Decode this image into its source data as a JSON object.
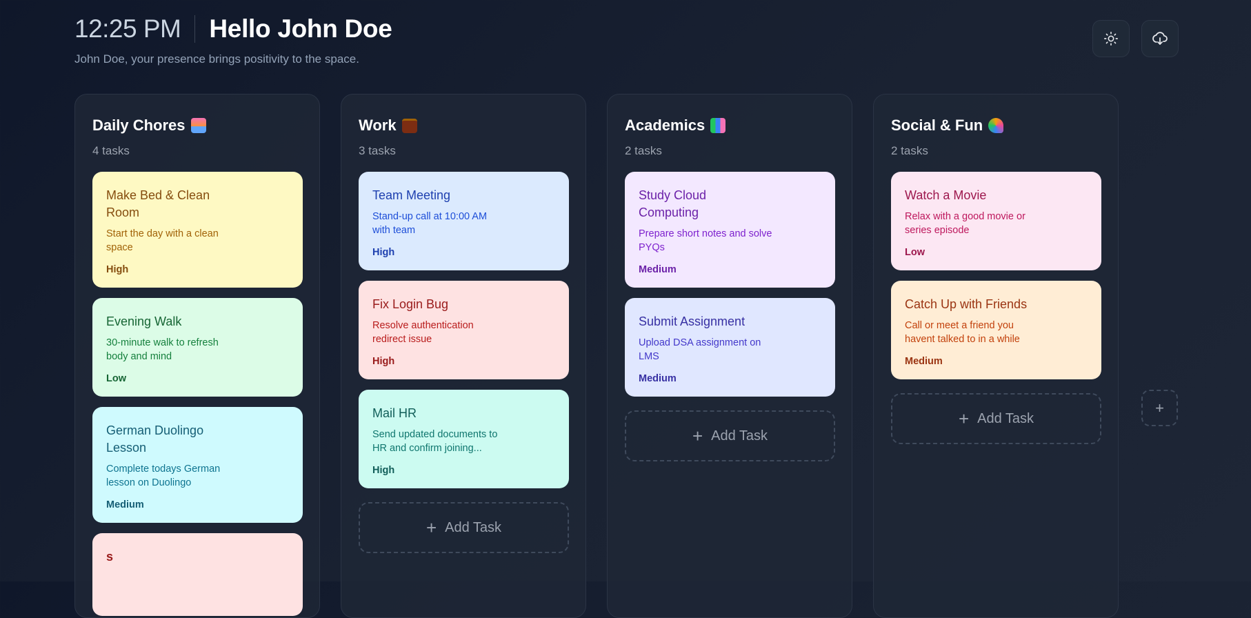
{
  "header": {
    "time": "12:25 PM",
    "greeting": "Hello John Doe",
    "subtitle": "John Doe, your presence brings positivity to the space."
  },
  "actions": [
    {
      "icon": "sun-icon"
    },
    {
      "icon": "cloud-download-icon"
    }
  ],
  "columns": [
    {
      "title": "Daily Chores",
      "count": "4 tasks",
      "cards": [
        {
          "title": "Make Bed & Clean Room",
          "desc": "Start the day with a clean space",
          "priority": "High",
          "theme": "yellow"
        },
        {
          "title": "Evening Walk",
          "desc": "30-minute walk to refresh body and mind",
          "priority": "Low",
          "theme": "green"
        },
        {
          "title": "German Duolingo Lesson",
          "desc": "Complete todays German lesson on Duolingo",
          "priority": "Medium",
          "theme": "cyan"
        },
        {
          "title": "s",
          "desc": "",
          "priority": "",
          "theme": "red"
        }
      ]
    },
    {
      "title": "Work",
      "count": "3 tasks",
      "cards": [
        {
          "title": "Team Meeting",
          "desc": "Stand-up call at 10:00 AM with team",
          "priority": "High",
          "theme": "blue"
        },
        {
          "title": "Fix Login Bug",
          "desc": "Resolve authentication redirect issue",
          "priority": "High",
          "theme": "red"
        },
        {
          "title": "Mail HR",
          "desc": "Send updated documents to HR and confirm joining...",
          "priority": "High",
          "theme": "teal"
        }
      ],
      "add_label": "Add Task"
    },
    {
      "title": "Academics",
      "count": "2 tasks",
      "cards": [
        {
          "title": "Study Cloud Computing",
          "desc": "Prepare short notes and solve PYQs",
          "priority": "Medium",
          "theme": "purple"
        },
        {
          "title": "Submit Assignment",
          "desc": "Upload DSA assignment on LMS",
          "priority": "Medium",
          "theme": "indigo"
        }
      ],
      "add_label": "Add Task"
    },
    {
      "title": "Social & Fun",
      "count": "2 tasks",
      "cards": [
        {
          "title": "Watch a Movie",
          "desc": "Relax with a good movie or series episode",
          "priority": "Low",
          "theme": "pink"
        },
        {
          "title": "Catch Up with Friends",
          "desc": "Call or meet a friend you havent talked to in a while",
          "priority": "Medium",
          "theme": "orange"
        }
      ],
      "add_label": "Add Task"
    }
  ],
  "add_column_label": "+"
}
